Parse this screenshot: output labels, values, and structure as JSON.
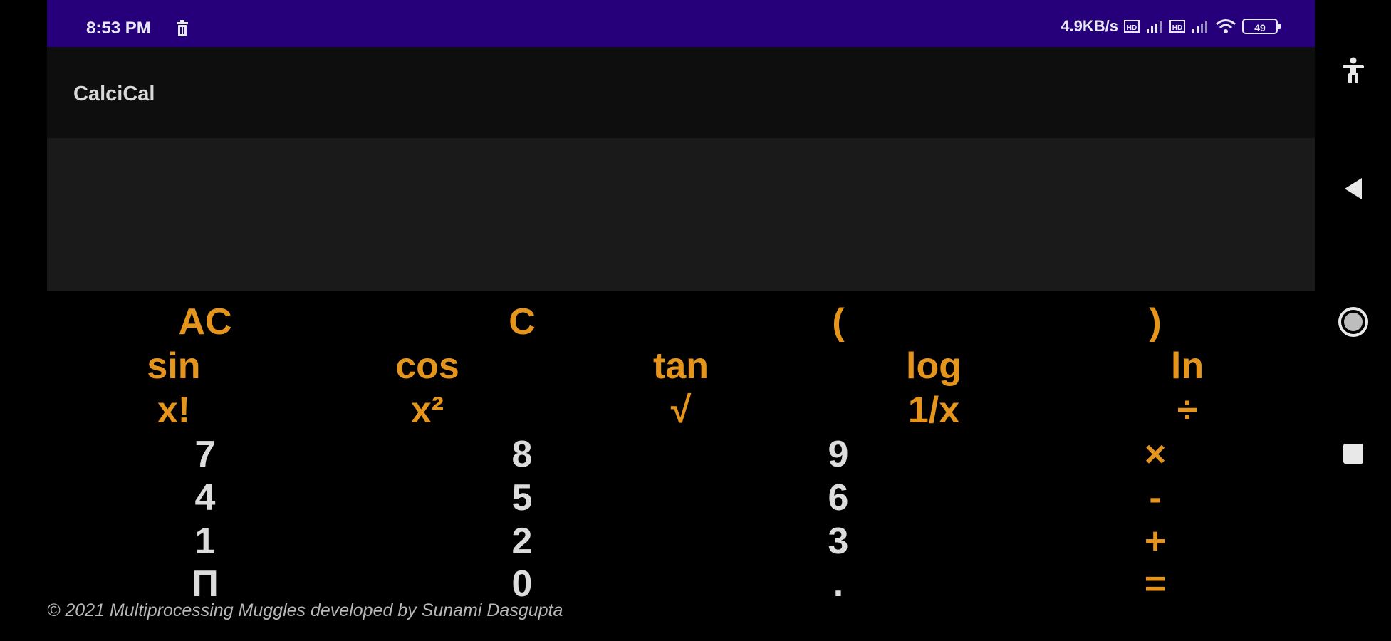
{
  "status_bar": {
    "time": "8:53 PM",
    "network_speed": "4.9KB/s",
    "battery_level": "49"
  },
  "app": {
    "title": "CalciCal"
  },
  "display": {
    "value": ""
  },
  "keypad": {
    "row1": [
      "AC",
      "C",
      "(",
      ")"
    ],
    "row2": [
      "sin",
      "cos",
      "tan",
      "log",
      "ln"
    ],
    "row3": [
      "x!",
      "x²",
      "√",
      "1/x",
      "÷"
    ],
    "row4": [
      "7",
      "8",
      "9",
      "×"
    ],
    "row5": [
      "4",
      "5",
      "6",
      "-"
    ],
    "row6": [
      "1",
      "2",
      "3",
      "+"
    ],
    "row7": [
      "Π",
      "0",
      ".",
      "="
    ]
  },
  "footer": {
    "text": "© 2021 Multiprocessing Muggles developed by Sunami Dasgupta"
  },
  "colors": {
    "status_bar": "#25007a",
    "accent": "#e6951c",
    "digit": "#dcdcdc",
    "app_bar": "#0e0e0e",
    "display_bg": "#1a1a1a"
  },
  "icons": {
    "status": [
      "trash-icon",
      "volte-sim1-icon",
      "signal-icon",
      "volte-sim2-icon",
      "wifi-icon",
      "battery-icon"
    ],
    "nav": [
      "accessibility-icon",
      "back-icon",
      "home-icon",
      "recents-icon"
    ]
  }
}
